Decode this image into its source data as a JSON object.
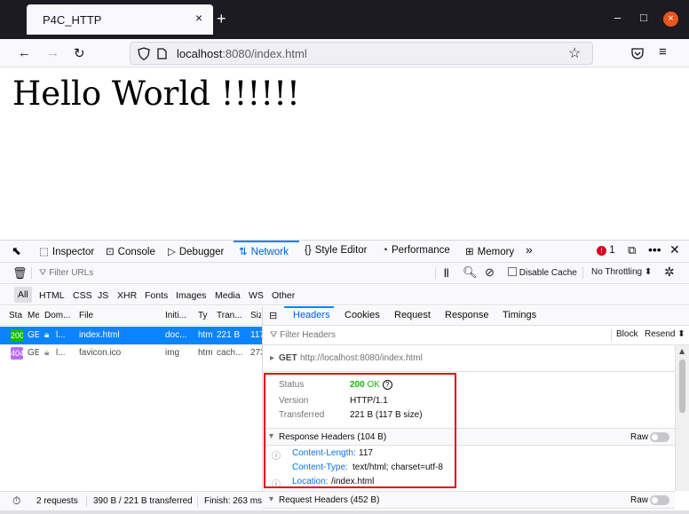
{
  "browser": {
    "tab_title": "P4C_HTTP",
    "tab_close": "×",
    "new_tab": "+",
    "win_minimize": "–",
    "win_maximize": "□",
    "win_close": "×",
    "url_host": "localhost",
    "url_rest": ":8080/index.html",
    "accent_close_color": "#e95420"
  },
  "page": {
    "heading": "Hello World !!!!!!"
  },
  "devtools": {
    "tools": [
      "Inspector",
      "Console",
      "Debugger",
      "Network",
      "Style Editor",
      "Performance",
      "Memory"
    ],
    "more": "»",
    "error_count": "1",
    "filter_placeholder": "Filter URLs",
    "pause": "||",
    "disable_cache": "Disable Cache",
    "throttling": "No Throttling ⬍",
    "types": [
      "All",
      "HTML",
      "CSS",
      "JS",
      "XHR",
      "Fonts",
      "Images",
      "Media",
      "WS",
      "Other"
    ],
    "columns": [
      "Sta",
      "Me",
      "Dom...",
      "File",
      "Initi...",
      "Ty",
      "Tran...",
      "Siz"
    ],
    "requests": [
      {
        "status": "200",
        "method": "GET",
        "domain": "l...",
        "file": "index.html",
        "initiator": "doc...",
        "type": "htm",
        "transferred": "221 B",
        "size": "117",
        "status_color": "#12bc00",
        "selected": true
      },
      {
        "status": "404",
        "method": "GET",
        "domain": "l...",
        "file": "favicon.ico",
        "initiator": "img",
        "type": "htm",
        "transferred": "cach...",
        "size": "273",
        "status_color": "#b56cf2",
        "selected": false
      }
    ],
    "status_bar": {
      "requests": "2 requests",
      "transferred": "390 B / 221 B transferred",
      "finish": "Finish: 263 ms"
    },
    "detail_tabs": [
      "Headers",
      "Cookies",
      "Request",
      "Response",
      "Timings"
    ],
    "filter_headers": "Filter Headers",
    "block": "Block",
    "resend": "Resend ⬍",
    "request_line": {
      "method": "GET",
      "url": "http://localhost:8080/index.html"
    },
    "summary": {
      "status_label": "Status",
      "status_code": "200",
      "status_text": "OK",
      "version_label": "Version",
      "version": "HTTP/1.1",
      "transferred_label": "Transferred",
      "transferred": "221 B (117 B size)"
    },
    "response_headers_title": "Response Headers (104 B)",
    "request_headers_title": "Request Headers (452 B)",
    "raw": "Raw",
    "response_headers": [
      {
        "name": "Content-Length:",
        "value": "117"
      },
      {
        "name": "Content-Type:",
        "value": "text/html; charset=utf-8"
      },
      {
        "name": "Location:",
        "value": "/index.html"
      }
    ]
  }
}
